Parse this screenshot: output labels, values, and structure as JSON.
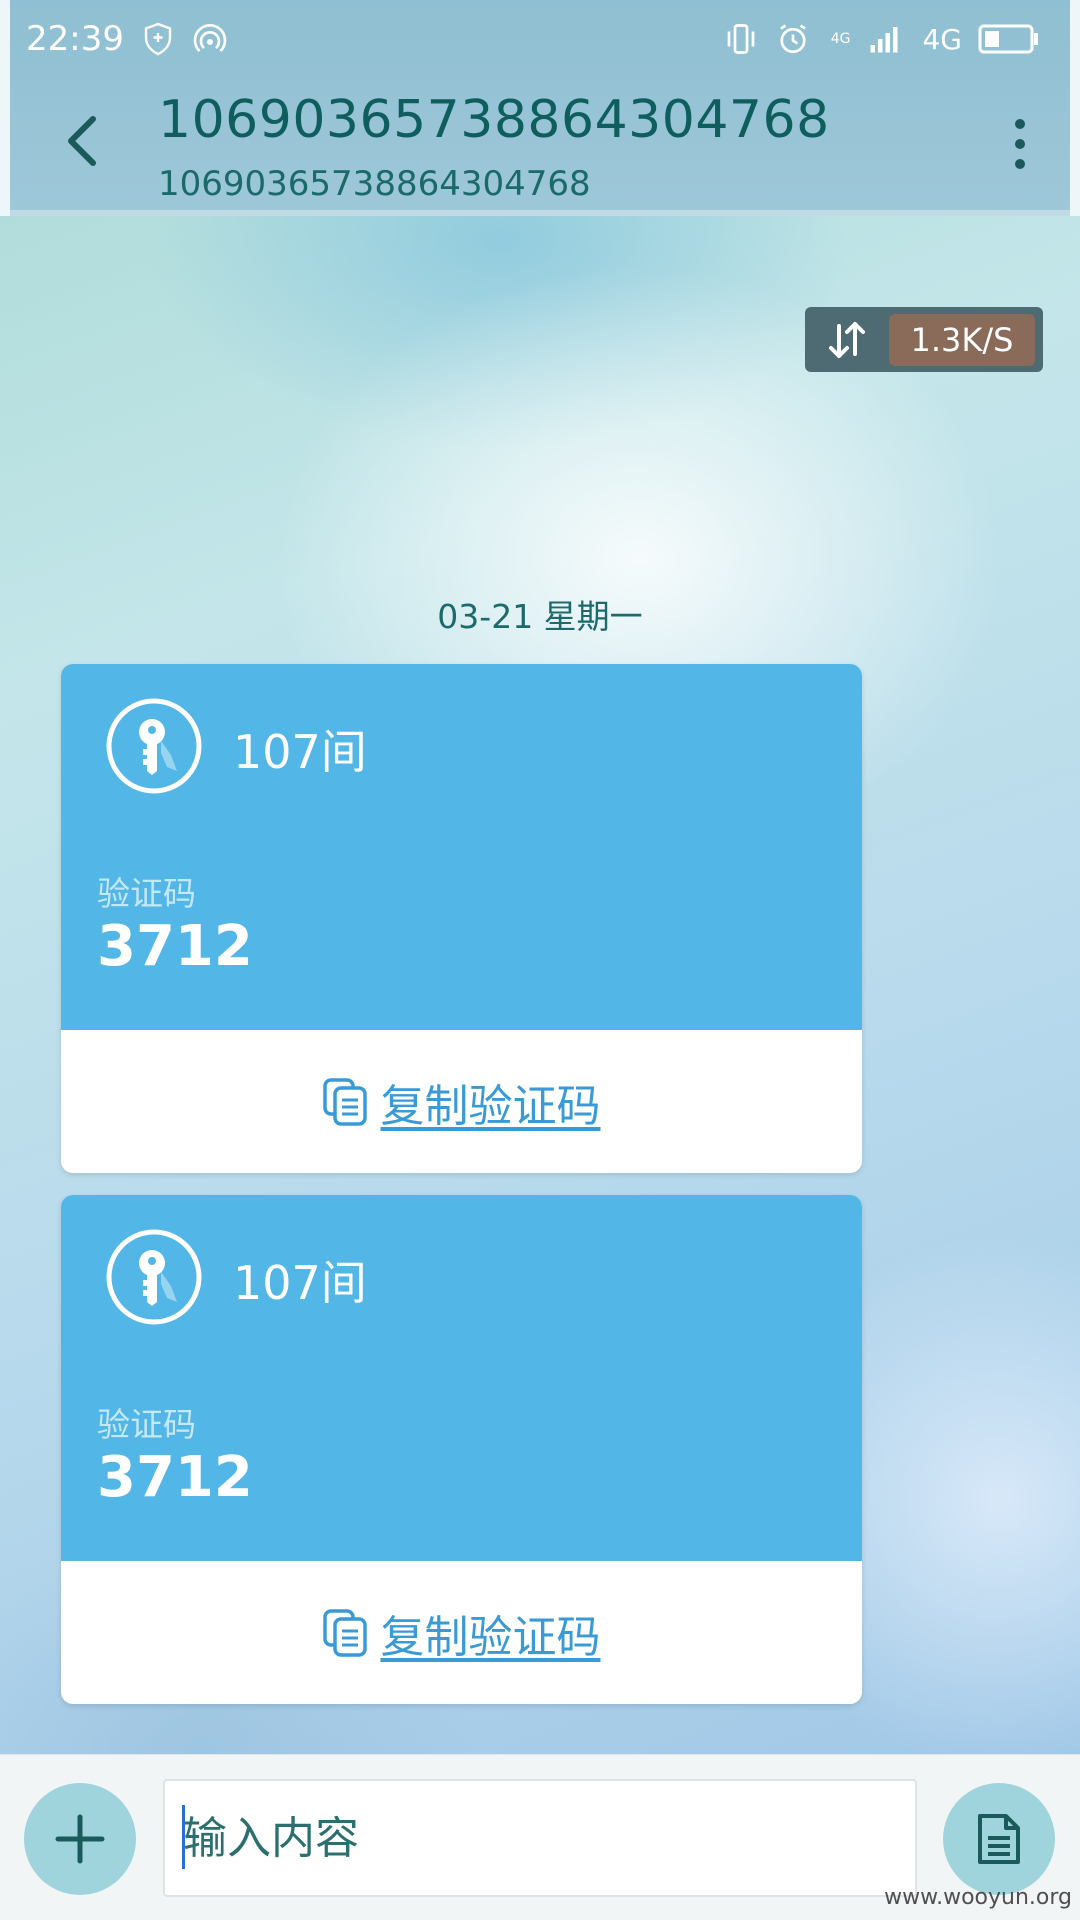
{
  "status_bar": {
    "time": "22:39",
    "network": "4G",
    "network_small": "4G",
    "icons": [
      "shield-icon",
      "hotspot-icon",
      "vibrate-icon",
      "alarm-icon",
      "signal-icon",
      "battery-icon"
    ]
  },
  "app_bar": {
    "title": "106903657388643047​68",
    "subtitle": "10690365738864304768"
  },
  "speed_badge": {
    "value": "1.3K/S"
  },
  "thread": {
    "date": "03-21  星期一"
  },
  "messages": [
    {
      "sender": "107间",
      "code_label": "验证码",
      "code": "3712",
      "copy_label": "复制验证码"
    },
    {
      "sender": "107间",
      "code_label": "验证码",
      "code": "3712",
      "copy_label": "复制验证码"
    }
  ],
  "composer": {
    "placeholder": "输入内容"
  },
  "watermark": "www.wooyun.org",
  "colors": {
    "card_blue": "#52b6e6",
    "title_teal": "#0f5e5e",
    "link_blue": "#3a9ad6"
  }
}
